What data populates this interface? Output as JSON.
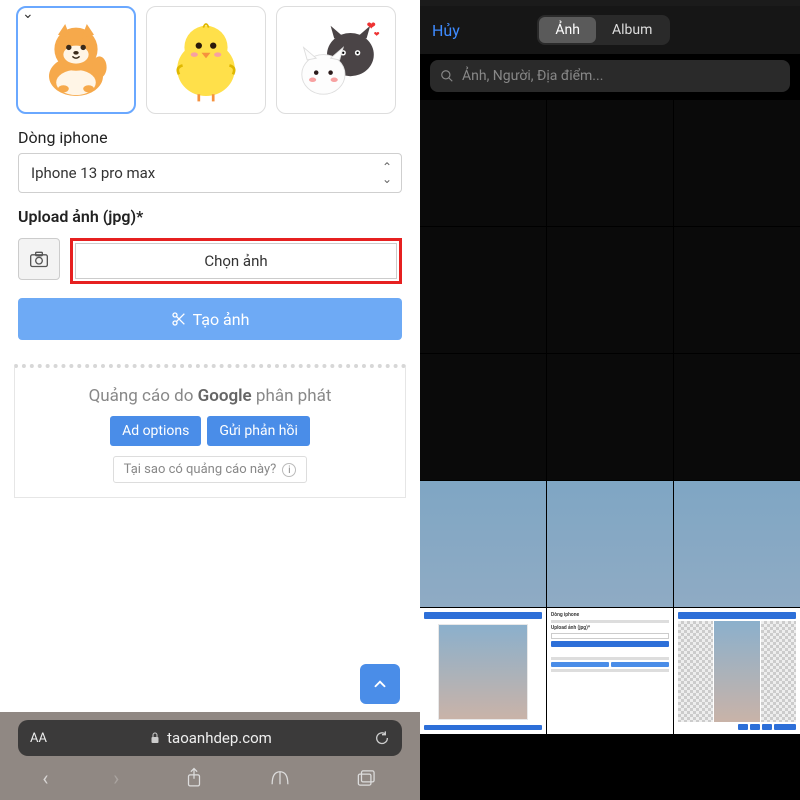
{
  "left": {
    "stickers": [
      "shiba-sticker",
      "chick-sticker",
      "cats-sticker"
    ],
    "phone_label": "Dòng iphone",
    "phone_value": "Iphone 13 pro max",
    "upload_label": "Upload ảnh (jpg)*",
    "choose_label": "Chọn ảnh",
    "create_label": "Tạo ảnh",
    "ad": {
      "prefix": "Quảng cáo do ",
      "google": "Google",
      "suffix": " phân phát",
      "options": "Ad options",
      "feedback": "Gửi phản hồi",
      "why": "Tại sao có quảng cáo này?"
    },
    "url_aa": "AA",
    "url_domain": "taoanhdep.com"
  },
  "right": {
    "cancel": "Hủy",
    "seg_photo": "Ảnh",
    "seg_album": "Album",
    "search_placeholder": "Ảnh, Người, Địa điểm..."
  }
}
